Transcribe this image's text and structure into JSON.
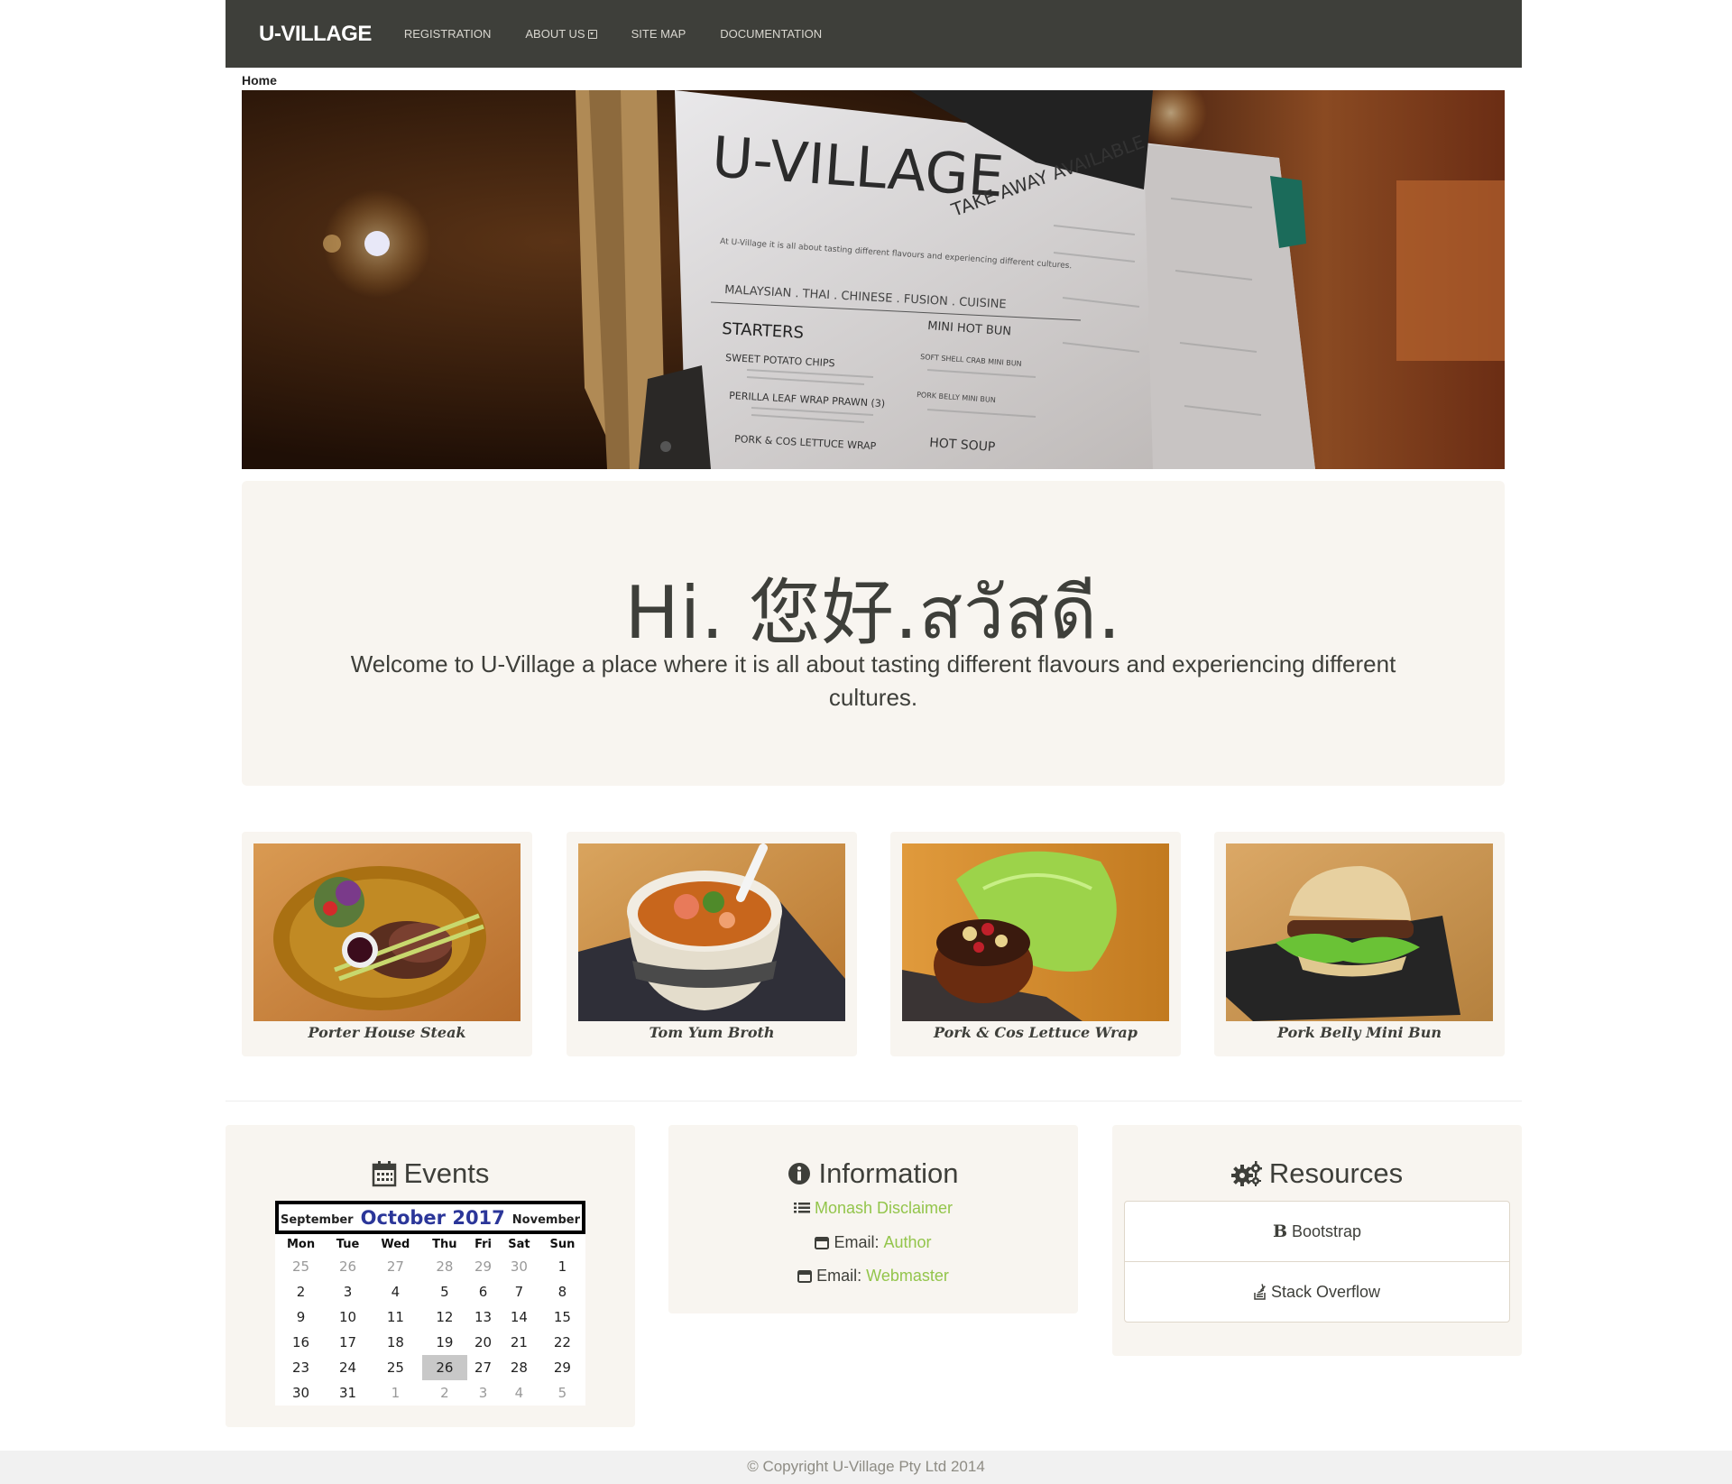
{
  "navbar": {
    "brand": "U-VILLAGE",
    "links": [
      "REGISTRATION",
      "ABOUT US",
      "SITE MAP",
      "DOCUMENTATION"
    ]
  },
  "breadcrumb": "Home",
  "hero": {
    "menu_title": "U-VILLAGE",
    "menu_badge": "TAKE AWAY AVAILABLE",
    "menu_subtitle": "At U-Village it is all about tasting different flavours and experiencing different cultures.",
    "menu_cuisines": "MALAYSIAN . THAI . CHINESE . FUSION . CUISINE",
    "menu_section": "STARTERS",
    "menu_items": [
      "SWEET POTATO CHIPS",
      "PERILLA LEAF WRAP PRAWN (3)",
      "PORK & COS LETTUCE WRAP"
    ],
    "menu_col2": [
      "MINI HOT BUN",
      "SOFT SHELL CRAB MINI BUN",
      "PORK BELLY MINI BUN",
      "HOT SOUP"
    ]
  },
  "jumbotron": {
    "heading": "Hi. 您好.สวัสดี.",
    "text": "Welcome to U-Village a place where it is all about tasting different flavours and experiencing different cultures."
  },
  "dishes": [
    {
      "caption": "Porter House Steak"
    },
    {
      "caption": "Tom Yum Broth"
    },
    {
      "caption": "Pork & Cos Lettuce Wrap"
    },
    {
      "caption": "Pork Belly Mini Bun"
    }
  ],
  "events": {
    "title": "Events",
    "calendar": {
      "prev": "September",
      "current": "October 2017",
      "next": "November",
      "weekdays": [
        "Mon",
        "Tue",
        "Wed",
        "Thu",
        "Fri",
        "Sat",
        "Sun"
      ],
      "weeks": [
        [
          "25",
          "26",
          "27",
          "28",
          "29",
          "30",
          "1"
        ],
        [
          "2",
          "3",
          "4",
          "5",
          "6",
          "7",
          "8"
        ],
        [
          "9",
          "10",
          "11",
          "12",
          "13",
          "14",
          "15"
        ],
        [
          "16",
          "17",
          "18",
          "19",
          "20",
          "21",
          "22"
        ],
        [
          "23",
          "24",
          "25",
          "26",
          "27",
          "28",
          "29"
        ],
        [
          "30",
          "31",
          "1",
          "2",
          "3",
          "4",
          "5"
        ]
      ],
      "today": "26"
    }
  },
  "information": {
    "title": "Information",
    "disclaimer": "Monash Disclaimer",
    "email_label": "Email:",
    "author": "Author",
    "webmaster": "Webmaster"
  },
  "resources": {
    "title": "Resources",
    "items": [
      "Bootstrap",
      "Stack Overflow"
    ],
    "bootstrap_glyph": "B"
  },
  "footer": "© Copyright U-Village Pty Ltd 2014",
  "colors": {
    "navbar": "#3e3f3a",
    "panel": "#f8f5f0",
    "link": "#93c54b",
    "calendar_title": "#2b3699"
  }
}
